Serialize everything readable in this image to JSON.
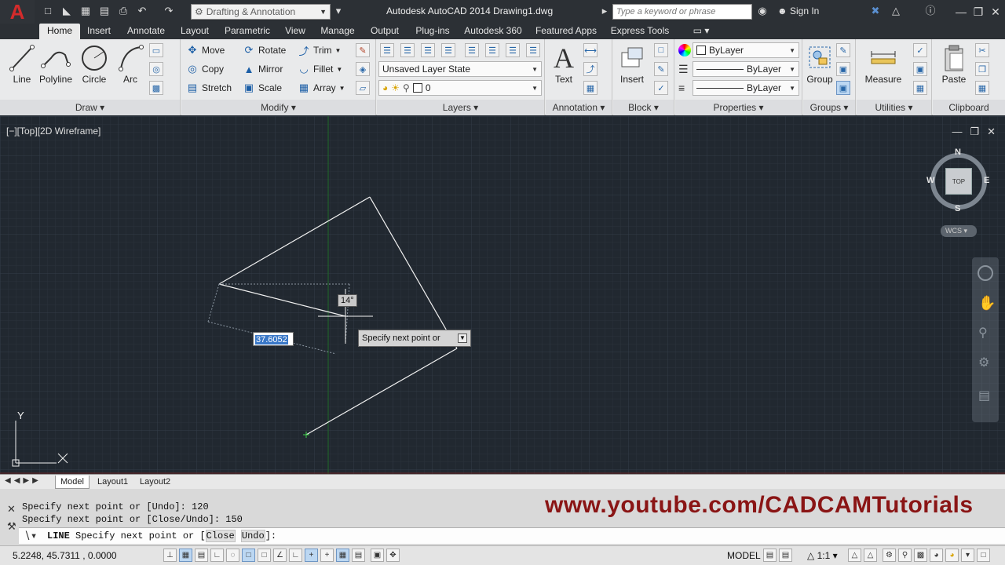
{
  "title_bar": {
    "workspace": "Drafting & Annotation",
    "app_title": "Autodesk AutoCAD 2014    Drawing1.dwg",
    "search_placeholder": "Type a keyword or phrase",
    "sign_in": "Sign In"
  },
  "menu_tabs": [
    "Home",
    "Insert",
    "Annotate",
    "Layout",
    "Parametric",
    "View",
    "Manage",
    "Output",
    "Plug-ins",
    "Autodesk 360",
    "Featured Apps",
    "Express Tools"
  ],
  "ribbon": {
    "draw": {
      "line": "Line",
      "polyline": "Polyline",
      "circle": "Circle",
      "arc": "Arc",
      "label": "Draw"
    },
    "modify": {
      "move": "Move",
      "rotate": "Rotate",
      "trim": "Trim",
      "copy": "Copy",
      "mirror": "Mirror",
      "fillet": "Fillet",
      "stretch": "Stretch",
      "scale": "Scale",
      "array": "Array",
      "label": "Modify"
    },
    "layers": {
      "layer_state": "Unsaved Layer State",
      "current_layer": "0",
      "label": "Layers"
    },
    "annotation": {
      "text": "Text",
      "label": "Annotation"
    },
    "block": {
      "insert": "Insert",
      "label": "Block"
    },
    "properties": {
      "color": "ByLayer",
      "linetype": "ByLayer",
      "lineweight": "ByLayer",
      "label": "Properties"
    },
    "groups": {
      "group": "Group",
      "label": "Groups"
    },
    "utilities": {
      "measure": "Measure",
      "label": "Utilities"
    },
    "clipboard": {
      "paste": "Paste",
      "label": "Clipboard"
    }
  },
  "viewport": {
    "label": "[−][Top][2D Wireframe]",
    "viewcube": {
      "north": "N",
      "south": "S",
      "east": "E",
      "west": "W",
      "face": "TOP",
      "wcs": "WCS"
    },
    "axis_y": "Y",
    "dynamic_input": {
      "angle": "14°",
      "length": "37.6052",
      "prompt": "Specify next point or"
    }
  },
  "layout_tabs": [
    "Model",
    "Layout1",
    "Layout2"
  ],
  "command_line": {
    "history": [
      "Specify next point or [Undo]: 120",
      "Specify next point or [Close/Undo]: 150"
    ],
    "command": "LINE",
    "prompt_prefix": "Specify next point or [",
    "option_close": "Close",
    "option_undo": "Undo",
    "prompt_suffix": "]:"
  },
  "watermark": "www.youtube.com/CADCAMTutorials",
  "status_bar": {
    "coordinates": "5.2248,  45.7311 , 0.0000",
    "model": "MODEL",
    "scale": "1:1"
  },
  "colors": {
    "canvas": "#212830",
    "titlebar": "#2c3035",
    "accent": "#d32b2b",
    "watermark": "#8a1515"
  }
}
